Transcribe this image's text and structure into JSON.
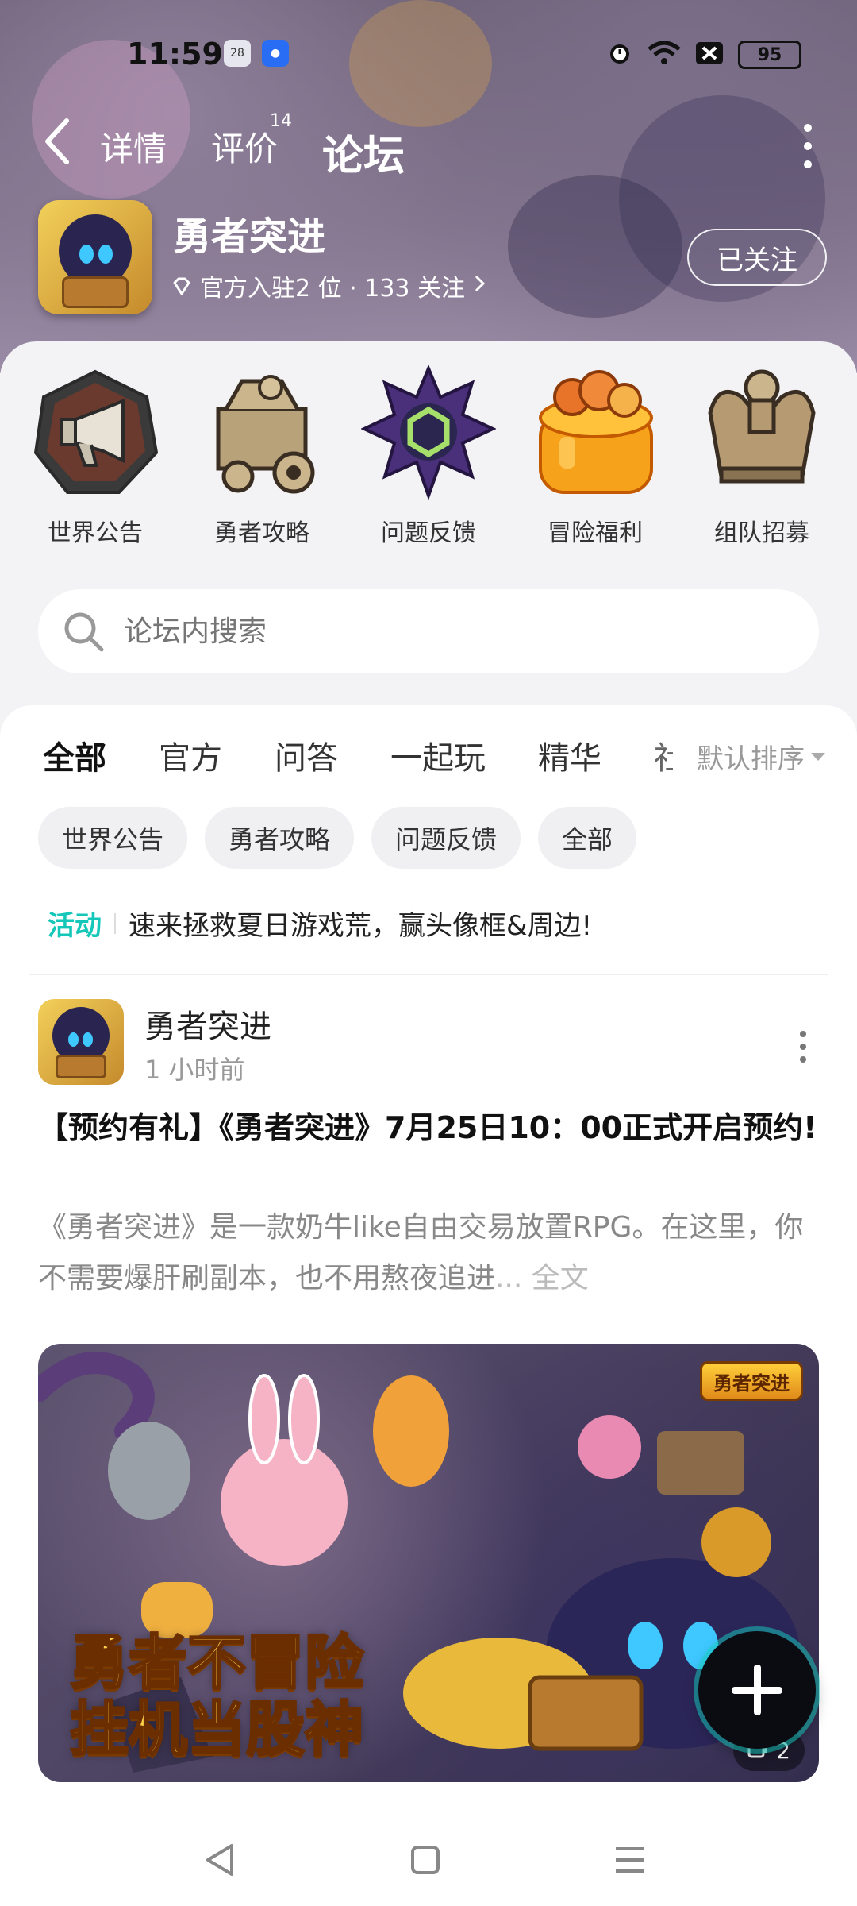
{
  "status_bar": {
    "time": "11:59",
    "mini_icons": [
      "28",
      "id"
    ],
    "battery": "95"
  },
  "top_nav": {
    "tabs": [
      {
        "label": "详情",
        "active": false
      },
      {
        "label": "评价",
        "badge": "14",
        "active": false
      },
      {
        "label": "论坛",
        "active": true
      }
    ]
  },
  "game": {
    "title": "勇者突进",
    "subtitle": "官方入驻2 位 · 133 关注",
    "follow_label": "已关注"
  },
  "quick_entries": [
    {
      "label": "世界公告",
      "icon": "megaphone-icon"
    },
    {
      "label": "勇者攻略",
      "icon": "map-cart-icon"
    },
    {
      "label": "问题反馈",
      "icon": "spiky-gem-icon"
    },
    {
      "label": "冒险福利",
      "icon": "jelly-cake-icon"
    },
    {
      "label": "组队招募",
      "icon": "crown-icon"
    }
  ],
  "search": {
    "placeholder": "论坛内搜索"
  },
  "category_tabs": [
    "全部",
    "官方",
    "问答",
    "一起玩",
    "精华",
    "社"
  ],
  "sort_label": "默认排序",
  "chips": [
    "世界公告",
    "勇者攻略",
    "问题反馈",
    "全部"
  ],
  "activity": {
    "tag": "活动",
    "text": "速来拯救夏日游戏荒，赢头像框&周边!"
  },
  "post": {
    "author": "勇者突进",
    "time": "1 小时前",
    "title": "【预约有礼】《勇者突进》7月25日10：00正式开启预约!",
    "excerpt": "《勇者突进》是一款奶牛like自由交易放置RPG。在这里，你不需要爆肝刷副本，也不用熬夜追进",
    "more_label": "... 全文",
    "banner_logo": "勇者突进",
    "banner_line1": "勇者不冒险",
    "banner_line2": "挂机当股神",
    "image_count": "2"
  },
  "colors": {
    "accent": "#18d3c4",
    "hero_bg": "#766a82"
  }
}
